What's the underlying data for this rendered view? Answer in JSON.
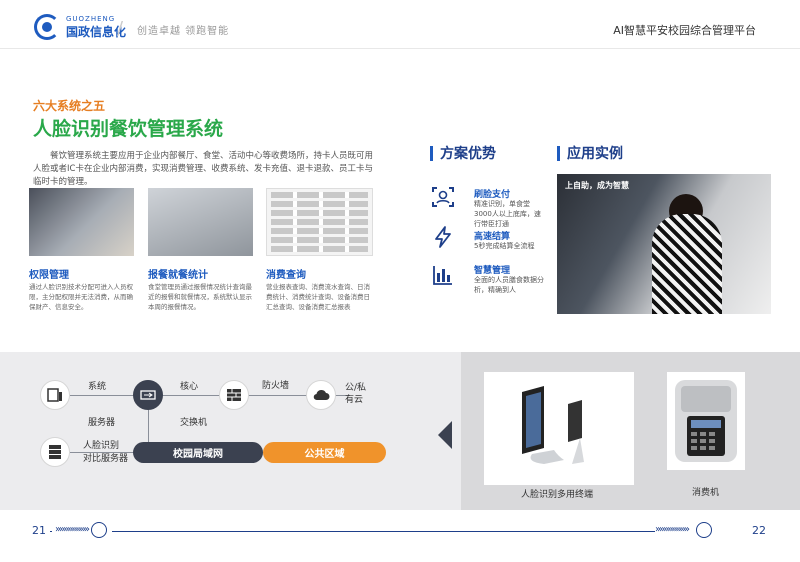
{
  "header": {
    "logo_en": "GUOZHENG",
    "logo_cn": "国政信息化",
    "slogan": "创造卓越 领跑智能",
    "platform_title": "AI智慧平安校园综合管理平台"
  },
  "section": {
    "number_label": "六大系统之五",
    "title": "人脸识别餐饮管理系统",
    "intro": "餐饮管理系统主要应用于企业内部餐厅、食堂、活动中心等收费场所，持卡人员既可用人脸或者IC卡在企业内部消费，实现消费管理、收费系统、发卡充值、退卡退款、员工卡与临时卡的管理。"
  },
  "features": [
    {
      "title": "权限管理",
      "text": "通过人脸识别技术分配可进入人员权限，主分配权限并无法消费，从而确保财产、信息安全。"
    },
    {
      "title": "报餐就餐统计",
      "text": "食堂管理员通过报餐情况统计查询最近的报餐和就餐情况，系统默认显示本周的报餐情况。"
    },
    {
      "title": "消费查询",
      "text": "营业报表查询、消费流水查询、日消费统计、消费统计查询、设备消费日汇总查询、设备消费汇总报表"
    }
  ],
  "advantages": {
    "heading": "方案优势",
    "items": [
      {
        "icon": "face-scan-icon",
        "title": "刷脸支付",
        "text": "精准识别，单食堂3000人以上底库，速行带臣打通"
      },
      {
        "icon": "lightning-icon",
        "title": "高速结算",
        "text": "5秒完成结算全流程"
      },
      {
        "icon": "bar-chart-icon",
        "title": "智慧管理",
        "text": "全面的人员膳食数据分析，精确到人"
      }
    ]
  },
  "cases": {
    "heading": "应用实例",
    "overlay_text": "上自助，成为智慧"
  },
  "network": {
    "system_label": "系统",
    "server_label": "服务器",
    "core_label": "核心",
    "switch_label": "交换机",
    "firewall_label": "防火墙",
    "cloud_label_1": "公/私",
    "cloud_label_2": "有云",
    "face_label_1": "人脸识别",
    "face_label_2": "对比服务器",
    "lan_label": "校园局域网",
    "public_label": "公共区域",
    "lan_color": "#3b4150",
    "public_color": "#f0932b"
  },
  "devices": [
    {
      "label": "人脸识别多用终端"
    },
    {
      "label": "消费机"
    }
  ],
  "footer": {
    "left_page": "21",
    "right_page": "22",
    "accent": "#1e3f8a"
  }
}
